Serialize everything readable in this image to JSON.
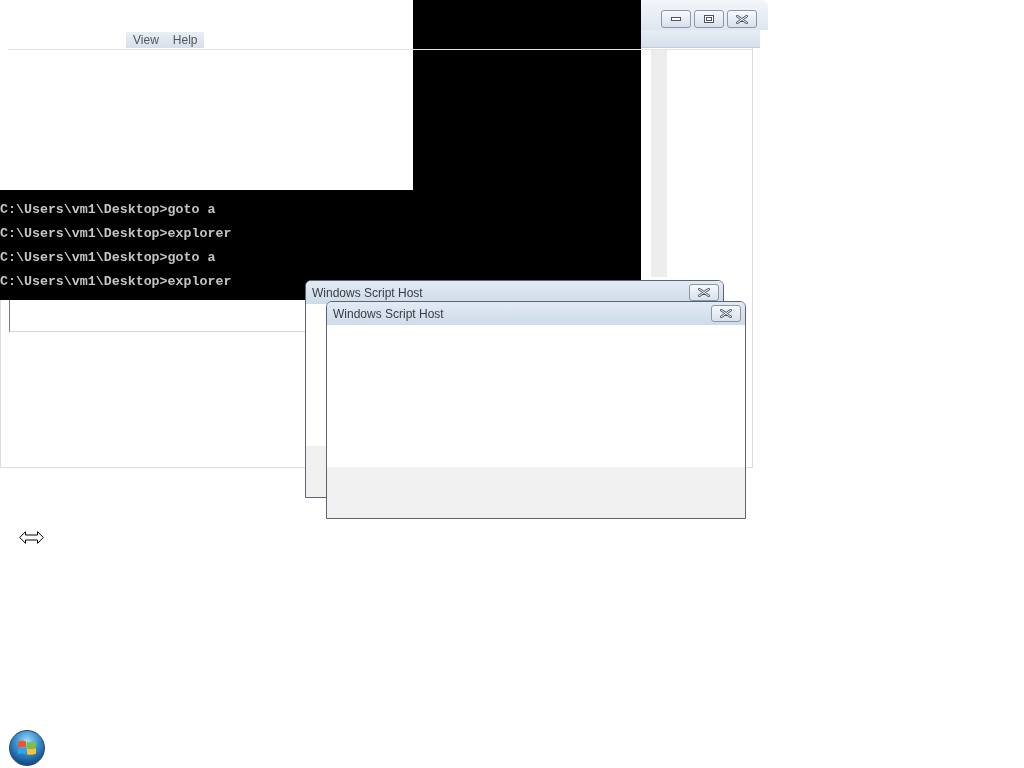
{
  "console": {
    "lines": [
      "C:\\Users\\vm1\\Desktop>goto a",
      "C:\\Users\\vm1\\Desktop>explorer",
      "C:\\Users\\vm1\\Desktop>goto a",
      "C:\\Users\\vm1\\Desktop>explorer"
    ]
  },
  "panel": {
    "menu_items": [
      {
        "label": "View"
      },
      {
        "label": "Help"
      }
    ]
  },
  "dialogs": [
    {
      "title": "Windows Script Host"
    },
    {
      "title": "Windows Script Host"
    }
  ]
}
